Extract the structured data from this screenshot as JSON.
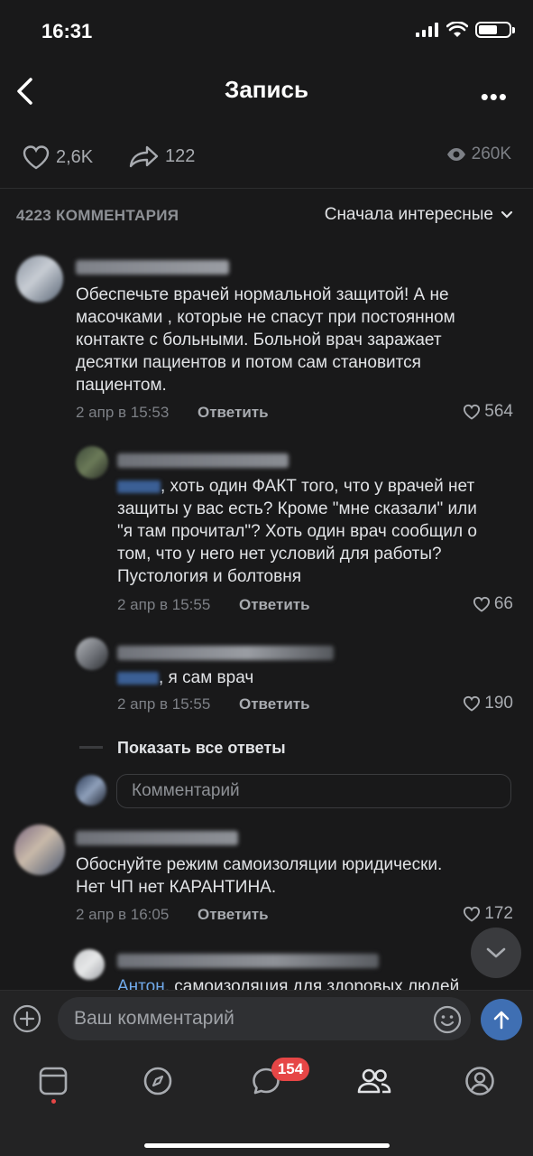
{
  "status_bar": {
    "time": "16:31"
  },
  "header": {
    "title": "Запись"
  },
  "post_stats": {
    "likes": "2,6K",
    "shares": "122",
    "views": "260K"
  },
  "comments_header": {
    "count_label": "4223 КОММЕНТАРИЯ",
    "sort_label": "Сначала интересные"
  },
  "comments": [
    {
      "text": "Обеспечьте врачей нормальной защитой! А не масочками , которые не спасут при постоянном контакте с больными. Больной врач заражает десятки пациентов и потом сам становится пациентом.",
      "lines": [
        "Обеспечьте врачей нормальной защитой! А не",
        "масочками , которые не спасут при постоянном",
        "контакте с больными. Больной врач заражает",
        "десятки пациентов и потом сам становится",
        "пациентом."
      ],
      "date": "2 апр в 15:53",
      "reply_label": "Ответить",
      "likes": "564"
    },
    {
      "lines_after_mention": [
        ", хоть один ФАКТ того, что у врачей нет"
      ],
      "lines": [
        "защиты у вас есть? Кроме \"мне сказали\" или",
        "\"я там прочитал\"? Хоть один врач сообщил о",
        "том, что у него нет условий для работы?",
        "Пустология и болтовня"
      ],
      "first_line": ", хоть один ФАКТ того, что у врачей нет",
      "date": "2 апр в 15:55",
      "reply_label": "Ответить",
      "likes": "66"
    },
    {
      "first_line": ", я сам врач",
      "date": "2 апр в 15:55",
      "reply_label": "Ответить",
      "likes": "190"
    },
    {
      "lines": [
        "Обоснуйте режим самоизоляции юридически.",
        "Нет ЧП нет КАРАНТИНА."
      ],
      "date": "2 апр в 16:05",
      "reply_label": "Ответить",
      "likes": "172"
    },
    {
      "mention": "Антон",
      "first_line": ", самоизоляция для здоровых людей"
    }
  ],
  "thread": {
    "show_all_label": "Показать все ответы",
    "reply_placeholder": "Комментарий"
  },
  "composer": {
    "placeholder": "Ваш комментарий"
  },
  "tabbar": {
    "messages_badge": "154"
  },
  "colors": {
    "background": "#19191a",
    "accent": "#3f6fb3",
    "badge": "#e64646",
    "link": "#71aaeb"
  },
  "icons": [
    "back-icon",
    "more-icon",
    "heart-icon",
    "share-icon",
    "eye-icon",
    "chevron-down-icon",
    "plus-icon",
    "emoji-icon",
    "send-icon",
    "news-icon",
    "discover-icon",
    "messages-icon",
    "friends-icon",
    "profile-icon"
  ]
}
